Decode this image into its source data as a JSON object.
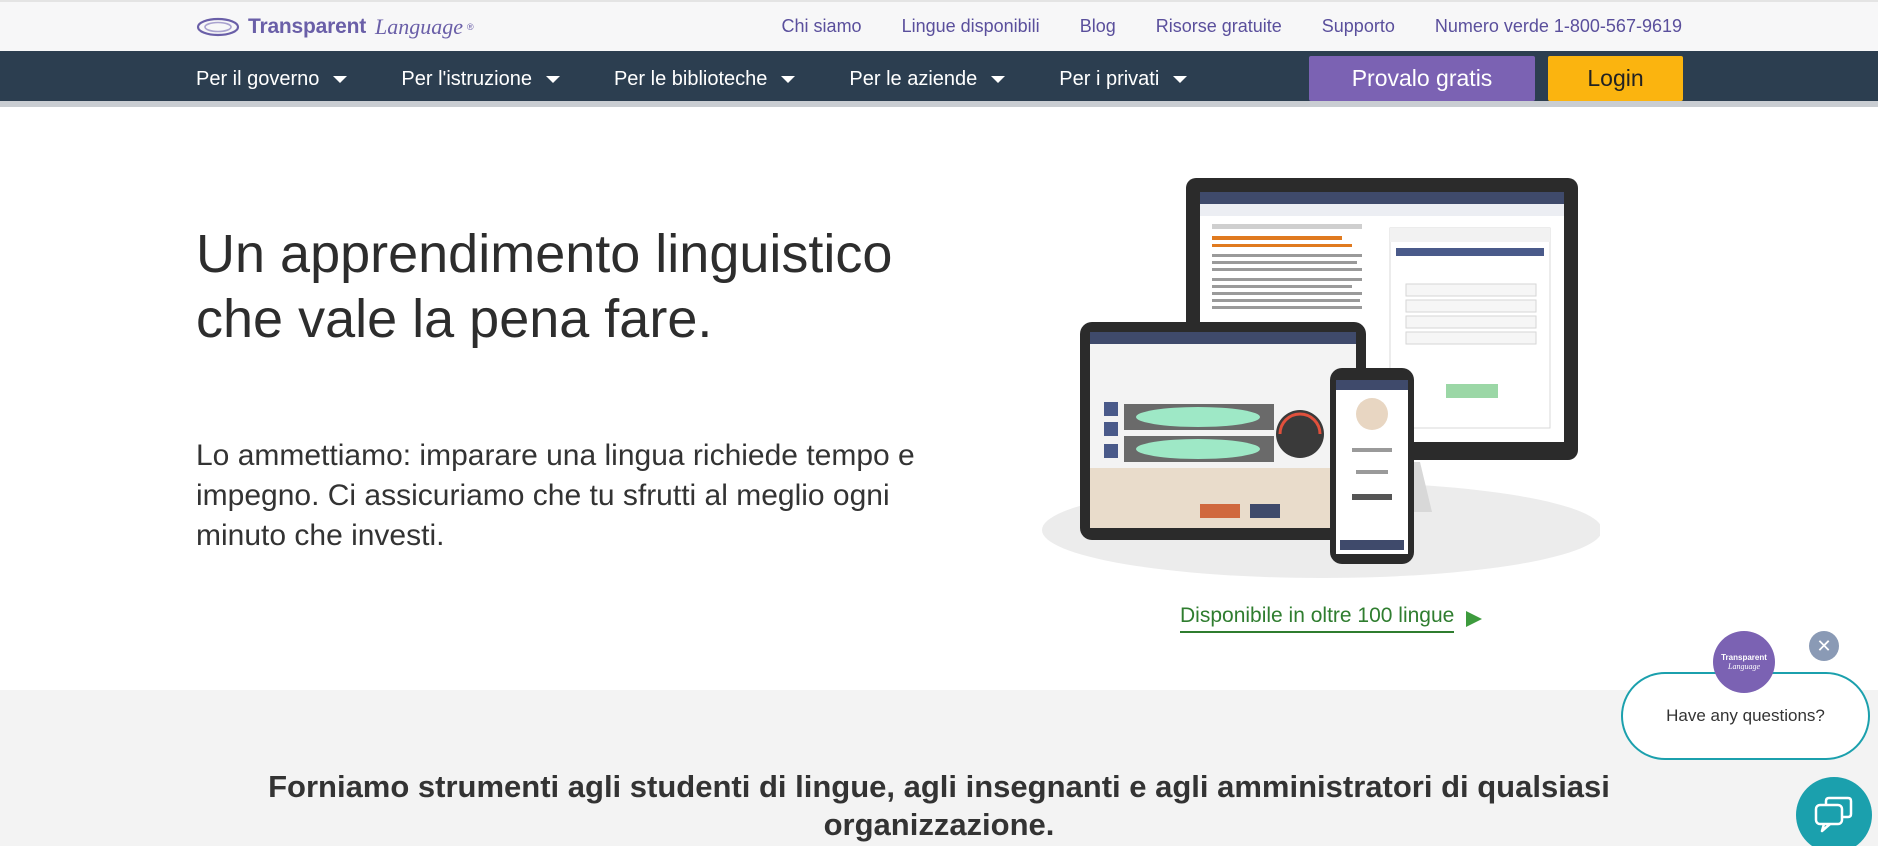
{
  "brand": {
    "name_bold": "Transparent",
    "name_italic": "Language",
    "reg": "®"
  },
  "top_links": [
    "Chi siamo",
    "Lingue disponibili",
    "Blog",
    "Risorse gratuite",
    "Supporto",
    "Numero verde 1-800-567-9619"
  ],
  "nav": {
    "items": [
      "Per il governo",
      "Per l'istruzione",
      "Per le biblioteche",
      "Per le aziende",
      "Per i privati"
    ],
    "try_label": "Provalo gratis",
    "login_label": "Login"
  },
  "hero": {
    "title": "Un apprendimento linguistico che vale la pena fare.",
    "subtitle": "Lo ammettiamo: imparare una lingua richiede tempo e impegno. Ci assicuriamo che tu sfrutti al meglio ogni minuto che investi.",
    "available_link": "Disponibile in oltre 100 lingue"
  },
  "section": {
    "heading": "Forniamo strumenti agli studenti di lingue, agli insegnanti e agli amministratori di qualsiasi organizzazione."
  },
  "chat": {
    "prompt": "Have any questions?",
    "avatar_line1": "Transparent",
    "avatar_line2": "Language",
    "close_glyph": "✕"
  },
  "colors": {
    "brand_purple": "#7b62b3",
    "nav_bg": "#2c3e50",
    "login_yellow": "#fbb40f",
    "link_green": "#2f7d2f",
    "chat_teal": "#1ba0ad"
  },
  "icons": [
    "logo-swoosh-icon",
    "caret-down-icon",
    "arrow-right-icon",
    "close-icon",
    "chat-icon"
  ]
}
